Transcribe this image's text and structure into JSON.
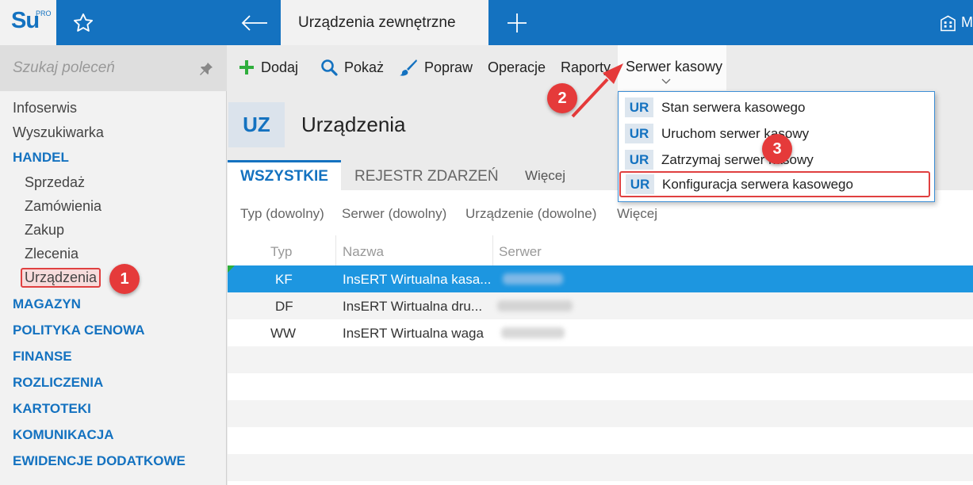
{
  "app": {
    "logo_text": "Su",
    "logo_sup": "PRO",
    "active_tab": "Urządzenia zewnętrzne",
    "building_label": "M"
  },
  "sidebar": {
    "search_placeholder": "Szukaj poleceń",
    "items": [
      {
        "label": "Infoserwis",
        "type": "item"
      },
      {
        "label": "Wyszukiwarka",
        "type": "item"
      },
      {
        "label": "HANDEL",
        "type": "section"
      },
      {
        "label": "Sprzedaż",
        "type": "sub"
      },
      {
        "label": "Zamówienia",
        "type": "sub"
      },
      {
        "label": "Zakup",
        "type": "sub"
      },
      {
        "label": "Zlecenia",
        "type": "sub"
      },
      {
        "label": "Urządzenia",
        "type": "sub",
        "selected": true
      },
      {
        "label": "MAGAZYN",
        "type": "section"
      },
      {
        "label": "POLITYKA CENOWA",
        "type": "section"
      },
      {
        "label": "FINANSE",
        "type": "section"
      },
      {
        "label": "ROZLICZENIA",
        "type": "section"
      },
      {
        "label": "KARTOTEKI",
        "type": "section"
      },
      {
        "label": "KOMUNIKACJA",
        "type": "section"
      },
      {
        "label": "EWIDENCJE DODATKOWE",
        "type": "section"
      }
    ]
  },
  "toolbar": {
    "add": "Dodaj",
    "show": "Pokaż",
    "edit": "Popraw",
    "operations": "Operacje",
    "reports": "Raporty",
    "server": "Serwer kasowy"
  },
  "page": {
    "badge": "UZ",
    "title": "Urządzenia",
    "tabs": {
      "all": "WSZYSTKIE",
      "events": "REJESTR ZDARZEŃ",
      "more": "Więcej"
    },
    "filters": [
      "Typ (dowolny)",
      "Serwer (dowolny)",
      "Urządzenie (dowolne)",
      "Więcej"
    ]
  },
  "grid": {
    "columns": [
      "Typ",
      "Nazwa",
      "Serwer"
    ],
    "rows": [
      {
        "typ": "KF",
        "nazwa": "InsERT Wirtualna kasa...",
        "selected": true
      },
      {
        "typ": "DF",
        "nazwa": "InsERT Wirtualna dru..."
      },
      {
        "typ": "WW",
        "nazwa": "InsERT Wirtualna waga"
      }
    ]
  },
  "dropdown": {
    "items": [
      {
        "badge": "UR",
        "label": "Stan serwera kasowego"
      },
      {
        "badge": "UR",
        "label": "Uruchom serwer kasowy"
      },
      {
        "badge": "UR",
        "label": "Zatrzymaj serwer kasowy"
      },
      {
        "badge": "UR",
        "label": "Konfiguracja serwera kasowego",
        "highlighted": true
      }
    ]
  },
  "annotations": {
    "one": "1",
    "two": "2",
    "three": "3"
  },
  "colors": {
    "brand": "#1472c0",
    "selection": "#1d96e0",
    "annotation": "#e53a3a",
    "add_icon": "#2fae3c"
  }
}
